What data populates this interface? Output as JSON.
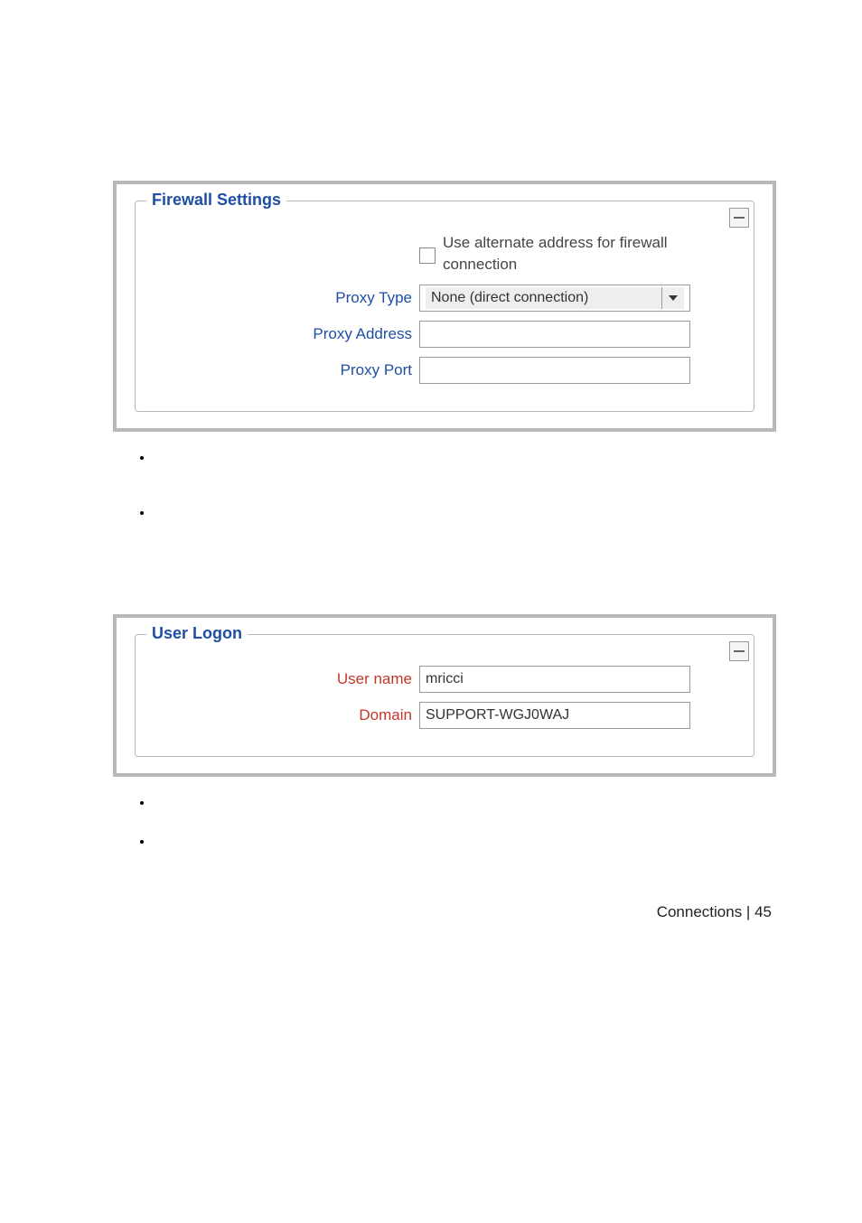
{
  "firewall": {
    "legend": "Firewall Settings",
    "use_alt_label": "Use alternate address for firewall connection",
    "proxy_type_label": "Proxy Type",
    "proxy_type_value": "None (direct connection)",
    "proxy_address_label": "Proxy Address",
    "proxy_address_value": "",
    "proxy_port_label": "Proxy Port",
    "proxy_port_value": ""
  },
  "user_logon": {
    "legend": "User Logon",
    "user_name_label": "User name",
    "user_name_value": "mricci",
    "domain_label": "Domain",
    "domain_value": "SUPPORT-WGJ0WAJ"
  },
  "footer": {
    "section": "Connections",
    "page": "45"
  }
}
